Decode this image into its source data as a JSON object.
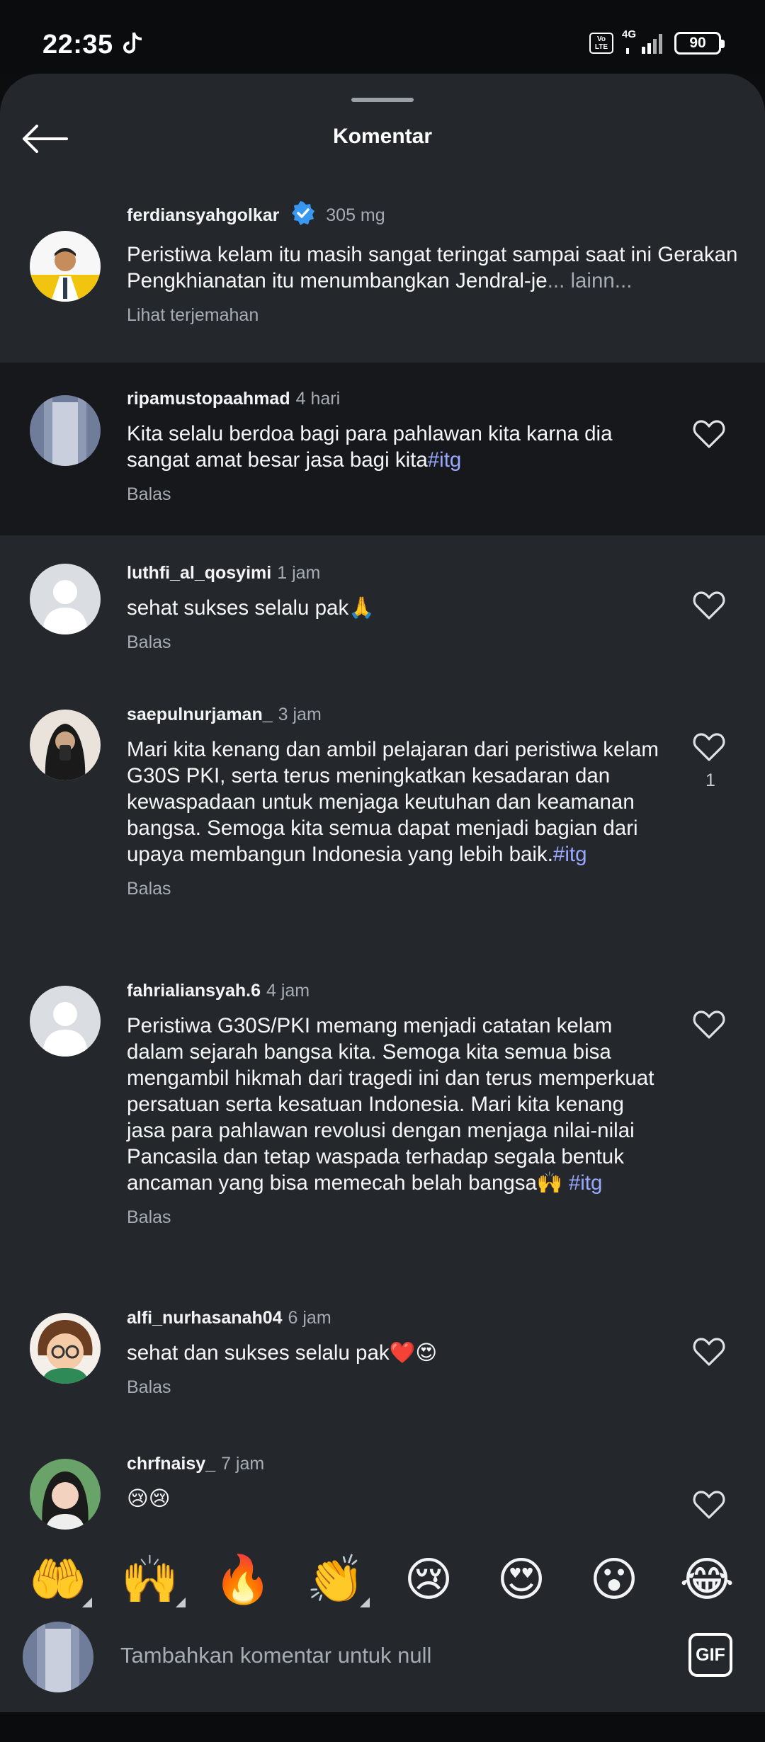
{
  "status_bar": {
    "time": "22:35",
    "network": "4G",
    "volte": "Vo LTE",
    "battery": "90"
  },
  "header": {
    "title": "Komentar",
    "back_icon": "arrow-left-icon"
  },
  "caption": {
    "username": "ferdiansyahgolkar",
    "verified": true,
    "time": "305 mg",
    "text": "Peristiwa kelam itu masih sangat teringat sampai saat ini Gerakan Pengkhianatan itu menumbangkan Jendral-je",
    "more": "... lainn...",
    "translate": "Lihat terjemahan"
  },
  "comments": [
    {
      "username": "ripamustopaahmad",
      "time": "4 hari",
      "text": "Kita selalu berdoa bagi para pahlawan kita karna dia sangat amat besar jasa bagi kita",
      "hashtag": "#itg",
      "reply": "Balas",
      "likes": ""
    },
    {
      "username": "luthfi_al_qosyimi",
      "time": "1 jam",
      "text": "sehat sukses selalu pak🙏",
      "hashtag": "",
      "reply": "Balas",
      "likes": ""
    },
    {
      "username": "saepulnurjaman_",
      "time": "3 jam",
      "text": "Mari kita kenang dan ambil pelajaran dari peristiwa kelam G30S PKI, serta terus meningkatkan kesadaran dan kewaspadaan untuk menjaga keutuhan dan keamanan bangsa. Semoga kita semua dapat menjadi bagian dari upaya membangun Indonesia yang lebih baik.",
      "hashtag": "#itg",
      "reply": "Balas",
      "likes": "1"
    },
    {
      "username": "fahrialiansyah.6",
      "time": "4 jam",
      "text": "Peristiwa G30S/PKI memang menjadi catatan kelam dalam sejarah bangsa kita. Semoga kita semua bisa mengambil hikmah dari tragedi ini dan terus memperkuat persatuan serta kesatuan Indonesia. Mari kita kenang jasa para pahlawan revolusi dengan menjaga nilai-nilai Pancasila dan tetap waspada terhadap segala bentuk ancaman yang bisa memecah belah bangsa🙌 ",
      "hashtag": "#itg",
      "reply": "Balas",
      "likes": ""
    },
    {
      "username": "alfi_nurhasanah04",
      "time": "6 jam",
      "text": "sehat dan sukses selalu pak❤️😍",
      "hashtag": "",
      "reply": "Balas",
      "likes": ""
    },
    {
      "username": "chrfnaisy_",
      "time": "7 jam",
      "text": "😢😢",
      "hashtag": "",
      "reply": "",
      "likes": ""
    }
  ],
  "emoji_bar": [
    "🤲",
    "🙌",
    "🔥",
    "👏",
    "😢",
    "😍",
    "😮",
    "😂"
  ],
  "composer": {
    "placeholder": "Tambahkan komentar untuk null",
    "gif_label": "GIF"
  },
  "colors": {
    "background": "#24272c",
    "highlight_row": "#17181b",
    "hashtag": "#9aa8ff",
    "verified": "#3897f0"
  }
}
